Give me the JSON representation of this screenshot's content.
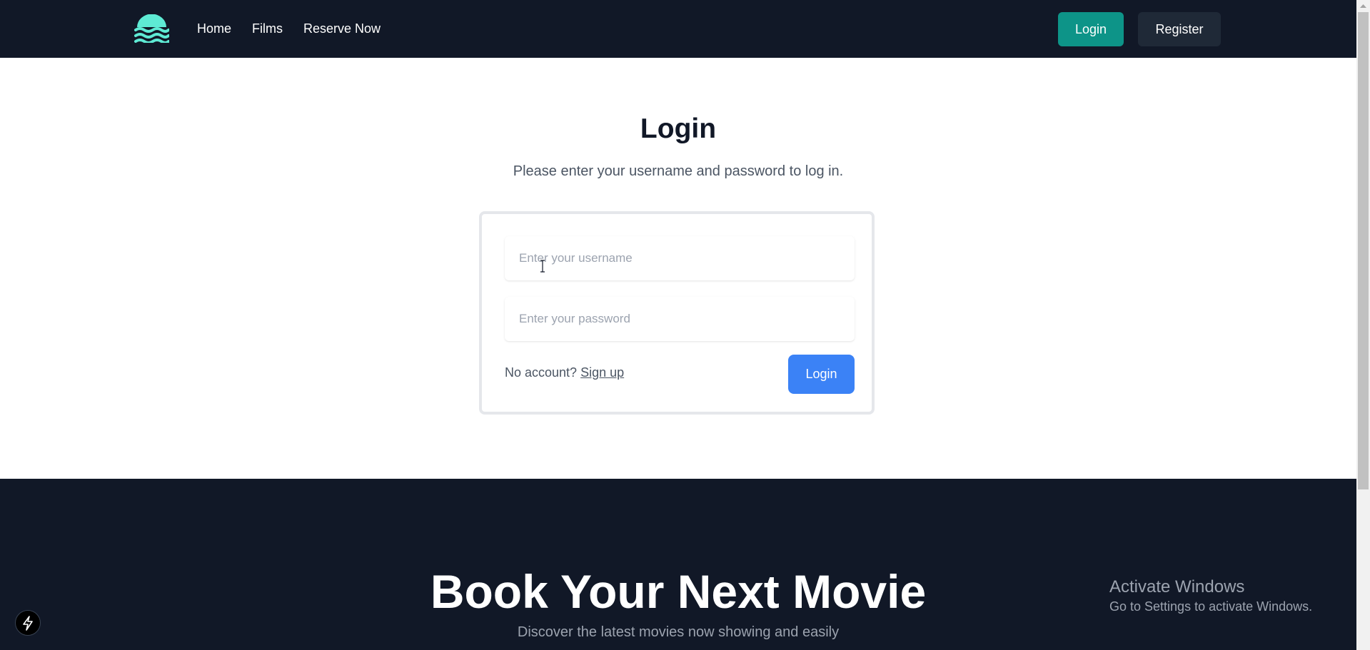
{
  "navbar": {
    "logo_icon": "wave-logo-icon",
    "links": [
      {
        "label": "Home"
      },
      {
        "label": "Films"
      },
      {
        "label": "Reserve Now"
      }
    ],
    "login_label": "Login",
    "register_label": "Register"
  },
  "login_section": {
    "title": "Login",
    "subtitle": "Please enter your username and password to log in.",
    "username_placeholder": "Enter your username",
    "username_value": "",
    "password_placeholder": "Enter your password",
    "password_value": "",
    "no_account_text": "No account?",
    "signup_label": "Sign up",
    "submit_label": "Login"
  },
  "hero": {
    "title": "Book Your Next Movie",
    "description": "Discover the latest movies now showing and easily"
  },
  "windows_watermark": {
    "title": "Activate Windows",
    "subtitle": "Go to Settings to activate Windows."
  },
  "colors": {
    "navbar_bg": "#111827",
    "login_button_bg": "#0d9488",
    "register_button_bg": "#1f2937",
    "form_button_bg": "#3b82f6"
  }
}
